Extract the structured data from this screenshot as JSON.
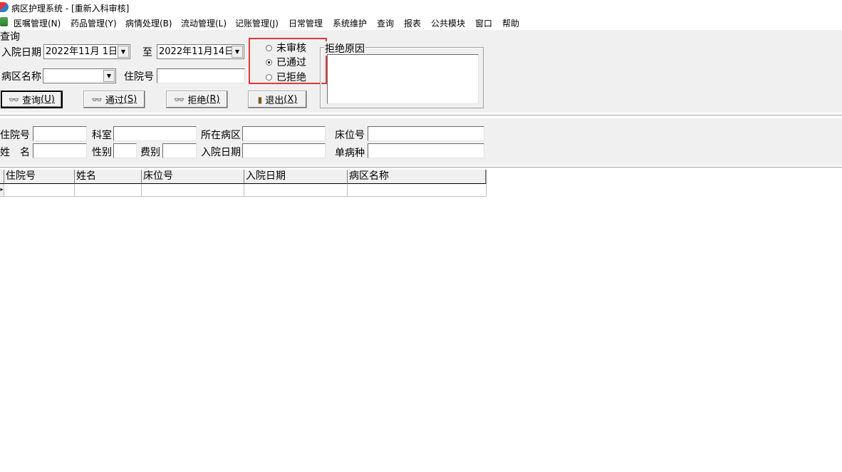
{
  "window": {
    "title": "病区护理系统 - [重新入科审核]"
  },
  "menu": {
    "items": [
      "医嘱管理(N)",
      "药品管理(Y)",
      "病情处理(B)",
      "流动管理(L)",
      "记账管理(J)",
      "日常管理",
      "系统维护",
      "查询",
      "报表",
      "公共模块",
      "窗口",
      "帮助"
    ]
  },
  "query": {
    "caption": "查询",
    "admit_date_label": "入院日期",
    "date_from": "2022年11月 1日",
    "to_label": "至",
    "date_to": "2022年11月14日",
    "ward_name_label": "病区名称",
    "ward_name_value": "",
    "inpatient_no_label": "住院号",
    "inpatient_no_value": ""
  },
  "buttons": {
    "query_text": "查询",
    "query_hotkey": "(U)",
    "pass_text": "通过",
    "pass_hotkey": "(S)",
    "reject_text": "拒绝",
    "reject_hotkey": "(R)",
    "exit_text": "退出",
    "exit_hotkey": "(X)"
  },
  "status_filter": {
    "options": [
      "未审核",
      "已通过",
      "已拒绝"
    ],
    "selected": "已通过"
  },
  "reject_reason": {
    "caption": "拒绝原因",
    "value": ""
  },
  "patient": {
    "inpatient_no_label": "住院号",
    "dept_label": "科室",
    "ward_label": "所在病区",
    "bed_label": "床位号",
    "name_label": "姓　名",
    "gender_label": "性别",
    "fee_type_label": "费别",
    "admit_date_label": "入院日期",
    "single_disease_label": "单病种"
  },
  "grid": {
    "columns": [
      "住院号",
      "姓名",
      "床位号",
      "入院日期",
      "病区名称"
    ],
    "rows": []
  },
  "colors": {
    "highlight": "#e03a3a",
    "panel": "#f0f0f0"
  }
}
